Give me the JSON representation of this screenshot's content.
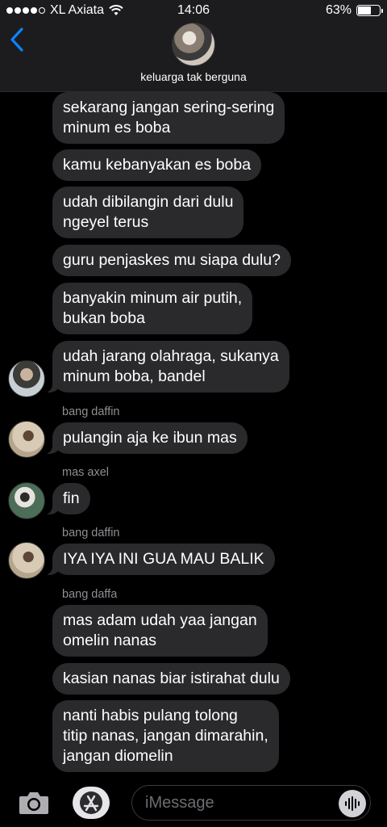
{
  "status_bar": {
    "carrier": "XL Axiata",
    "time": "14:06",
    "battery_percent": "63%",
    "battery_level": 0.63
  },
  "header": {
    "back_icon": "chevron-left-icon",
    "group_name": "keluarga tak berguna"
  },
  "messages": [
    {
      "lines": [
        "sekarang jangan sering-sering",
        "minum es boba"
      ]
    },
    {
      "lines": [
        "kamu kebanyakan es boba"
      ]
    },
    {
      "lines": [
        "udah dibilangin dari dulu",
        "ngeyel terus"
      ]
    },
    {
      "lines": [
        "guru penjaskes mu siapa dulu?"
      ]
    },
    {
      "lines": [
        "banyakin minum air putih,",
        "bukan boba"
      ]
    },
    {
      "lines": [
        "udah jarang olahraga, sukanya",
        "minum boba, bandel"
      ]
    },
    {
      "sender": "bang daffin",
      "lines": [
        "pulangin aja ke ibun mas"
      ]
    },
    {
      "sender": "mas axel",
      "lines": [
        "fin"
      ]
    },
    {
      "sender": "bang daffin",
      "lines": [
        "IYA IYA INI GUA MAU BALIK"
      ]
    },
    {
      "sender": "bang daffa",
      "lines": [
        "mas adam udah yaa jangan",
        "omelin nanas"
      ]
    },
    {
      "lines": [
        "kasian nanas biar istirahat dulu"
      ]
    },
    {
      "lines": [
        "nanti habis pulang tolong",
        "titip nanas, jangan dimarahin,",
        "jangan diomelin"
      ]
    }
  ],
  "input_bar": {
    "placeholder": "iMessage",
    "camera_icon": "camera-icon",
    "apps_icon": "app-store-icon",
    "audio_icon": "waveform-icon"
  },
  "colors": {
    "background": "#000000",
    "bubble": "#2a2a2c",
    "header": "#1c1c1e",
    "accent": "#0a84ff",
    "sender_label": "#8e8e93"
  }
}
